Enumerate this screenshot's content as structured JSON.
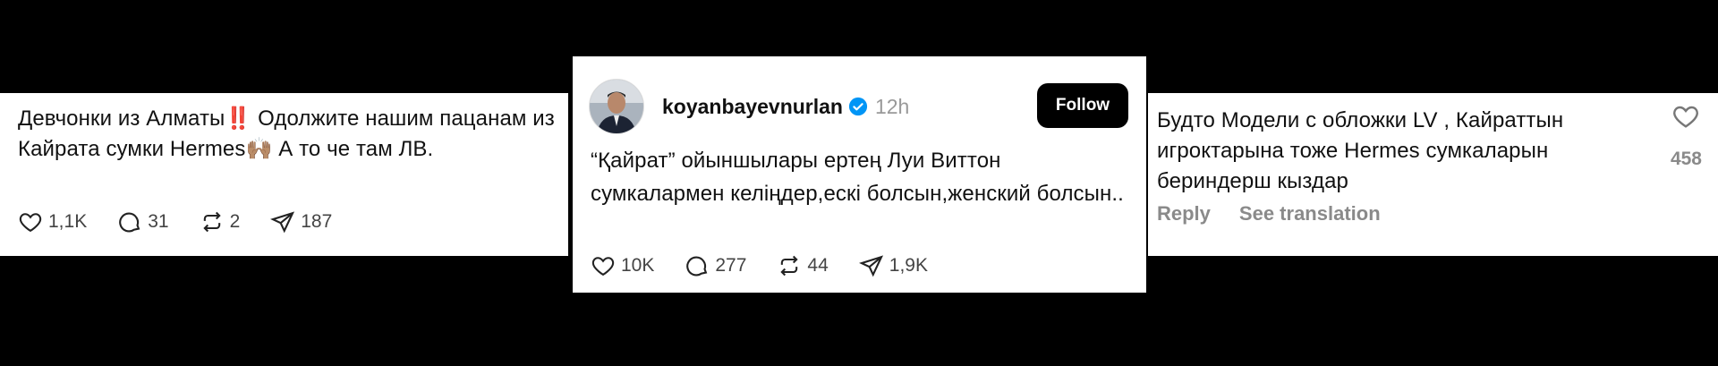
{
  "card1": {
    "text": "Девчонки из Алматы‼️ Одолжите нашим пацанам из Кайрата сумки Hermes🙌🏽 А то че там ЛВ.",
    "likes": "1,1K",
    "replies": "31",
    "reposts": "2",
    "shares": "187"
  },
  "card2": {
    "username": "koyanbayevnurlan",
    "time": "12h",
    "follow_label": "Follow",
    "text": "“Қайрат” ойыншылары ертең Луи Виттон сумкалармен келіңдер,ескі болсын,женский болсын..",
    "likes": "10K",
    "replies": "277",
    "reposts": "44",
    "shares": "1,9K",
    "accent": "#0095f6"
  },
  "card3": {
    "text": "Будто Модели с обложки LV , Кайраттын игроктарына тоже Hermes сумкаларын бериндерш кыздар",
    "reply_label": "Reply",
    "translate_label": "See translation",
    "likes": "458"
  }
}
